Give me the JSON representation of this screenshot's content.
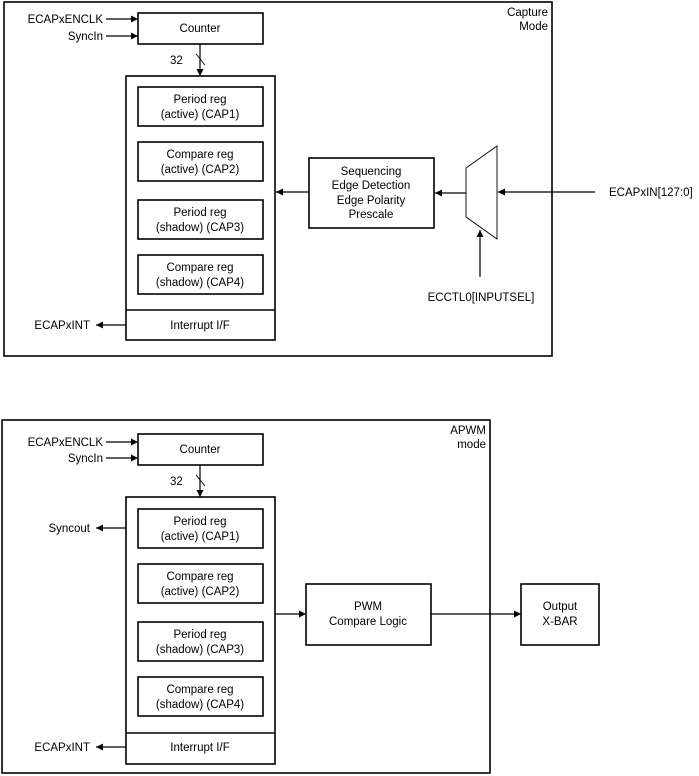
{
  "capture": {
    "mode_label": [
      "Capture",
      "Mode"
    ],
    "inputs": {
      "enclk": "ECAPxENCLK",
      "syncin": "SyncIn"
    },
    "counter": "Counter",
    "bus_width": "32",
    "registers": [
      [
        "Period reg",
        "(active) (CAP1)"
      ],
      [
        "Compare reg",
        "(active) (CAP2)"
      ],
      [
        "Period reg",
        "(shadow) (CAP3)"
      ],
      [
        "Compare reg",
        "(shadow) (CAP4)"
      ]
    ],
    "interrupt": "Interrupt I/F",
    "int_out": "ECAPxINT",
    "sequencer": [
      "Sequencing",
      "Edge Detection",
      "Edge Polarity",
      "Prescale"
    ],
    "mux_input": "ECAPxIN[127:0]",
    "mux_select": "ECCTL0[INPUTSEL]"
  },
  "apwm": {
    "mode_label": [
      "APWM",
      "mode"
    ],
    "inputs": {
      "enclk": "ECAPxENCLK",
      "syncin": "SyncIn"
    },
    "counter": "Counter",
    "bus_width": "32",
    "syncout": "Syncout",
    "registers": [
      [
        "Period reg",
        "(active) (CAP1)"
      ],
      [
        "Compare reg",
        "(active) (CAP2)"
      ],
      [
        "Period reg",
        "(shadow) (CAP3)"
      ],
      [
        "Compare reg",
        "(shadow) (CAP4)"
      ]
    ],
    "interrupt": "Interrupt I/F",
    "int_out": "ECAPxINT",
    "pwm_logic": [
      "PWM",
      "Compare Logic"
    ],
    "output": [
      "Output",
      "X-BAR"
    ]
  }
}
